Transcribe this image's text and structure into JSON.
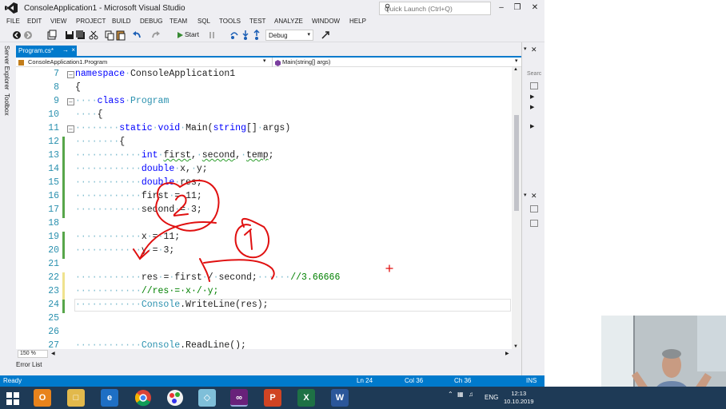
{
  "window": {
    "title": "ConsoleApplication1 - Microsoft Visual Studio",
    "quick_launch_placeholder": "Quick Launch (Ctrl+Q)"
  },
  "menu": [
    "FILE",
    "EDIT",
    "VIEW",
    "PROJECT",
    "BUILD",
    "DEBUG",
    "TEAM",
    "SQL",
    "TOOLS",
    "TEST",
    "ANALYZE",
    "WINDOW",
    "HELP"
  ],
  "toolbar": {
    "start_label": "Start",
    "config_value": "Debug"
  },
  "left_tabs": [
    "Server Explorer",
    "Toolbox"
  ],
  "document_tab": {
    "label": "Program.cs*",
    "pin": "→",
    "close": "×"
  },
  "navbar": {
    "class_dropdown": "ConsoleApplication1.Program",
    "member_dropdown": "Main(string[] args)"
  },
  "editor": {
    "line_numbers": [
      "7",
      "8",
      "9",
      "10",
      "11",
      "12",
      "13",
      "14",
      "15",
      "16",
      "17",
      "18",
      "19",
      "20",
      "21",
      "22",
      "23",
      "24",
      "25",
      "26",
      "27"
    ],
    "zoom": "150 %"
  },
  "bottom": {
    "error_list": "Error List"
  },
  "status": {
    "ready": "Ready",
    "ln": "Ln 24",
    "col": "Col 36",
    "ch": "Ch 36",
    "ins": "INS"
  },
  "right_panel": {
    "search": "Searc"
  },
  "taskbar": {
    "lang": "ENG",
    "time": "12:13",
    "date": "10.10.2019"
  },
  "colors": {
    "accent": "#007acc",
    "keyword": "#0000ff",
    "type": "#2b91af",
    "comment": "#008000",
    "annotation": "#e01010"
  }
}
